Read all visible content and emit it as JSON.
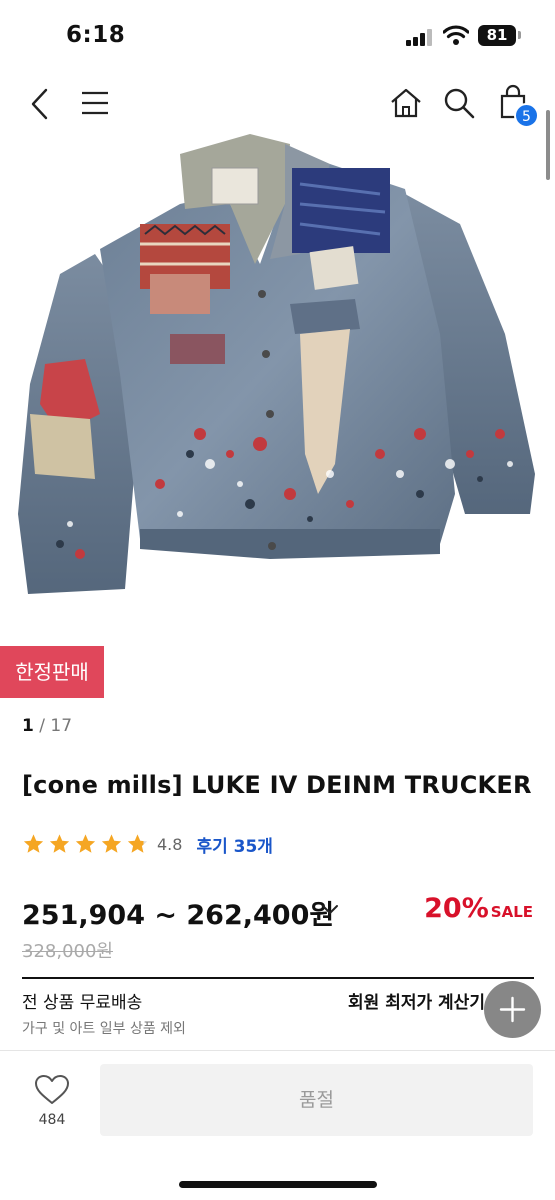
{
  "status": {
    "time": "6:18",
    "battery": "81"
  },
  "nav": {
    "cart_count": "5"
  },
  "badge": {
    "limited": "한정판매"
  },
  "gallery": {
    "current": "1",
    "separator": " / ",
    "total": "17"
  },
  "product": {
    "title": "[cone mills] LUKE IV DEINM TRUCKER",
    "rating": "4.8",
    "review_label": "후기 35개",
    "price_range": "251,904 ~ 262,400원",
    "discount_rate": "20%",
    "discount_label": "SALE",
    "original_price": "328,000원"
  },
  "shipping": {
    "title": "전 상품 무료배송",
    "note": "가구 및 아트 일부 상품 제외",
    "member_price_label": "회원 최저가 계산기"
  },
  "footer": {
    "wish_count": "484",
    "soldout_label": "품절"
  },
  "colors": {
    "sale_red": "#d8112a",
    "badge_red": "#e0475b",
    "link_blue": "#1a56c9",
    "cart_badge": "#1a73e8",
    "star": "#f5a623"
  },
  "icons": [
    "back-icon",
    "menu-icon",
    "home-icon",
    "search-icon",
    "cart-icon",
    "star-icon",
    "chevron-down-icon",
    "plus-icon",
    "heart-icon"
  ]
}
